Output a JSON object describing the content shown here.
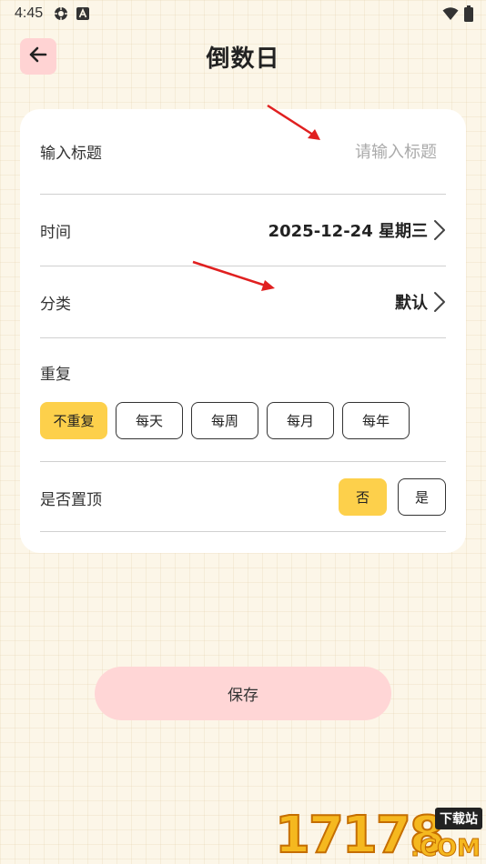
{
  "status_bar": {
    "time": "4:45",
    "icons": [
      "settings-gear-icon",
      "a-letter-icon",
      "wifi-icon",
      "battery-icon"
    ]
  },
  "header": {
    "back_icon": "arrow-left-icon",
    "title": "倒数日"
  },
  "form": {
    "title_row": {
      "label": "输入标题",
      "placeholder": "请输入标题"
    },
    "time_row": {
      "label": "时间",
      "value": "2025-12-24 星期三"
    },
    "category_row": {
      "label": "分类",
      "value": "默认"
    },
    "repeat": {
      "label": "重复",
      "options": [
        "不重复",
        "每天",
        "每周",
        "每月",
        "每年"
      ],
      "selected": "不重复"
    },
    "pin": {
      "label": "是否置顶",
      "options": [
        "否",
        "是"
      ],
      "selected": "否"
    }
  },
  "save_button": {
    "label": "保存"
  },
  "watermark": {
    "number": "17178",
    "badge": "下载站",
    "domain": ".COM"
  },
  "colors": {
    "background": "#fcf6e8",
    "accent_yellow": "#fdd04b",
    "accent_pink": "#ffd6d6",
    "annotation_red": "#e02020"
  }
}
